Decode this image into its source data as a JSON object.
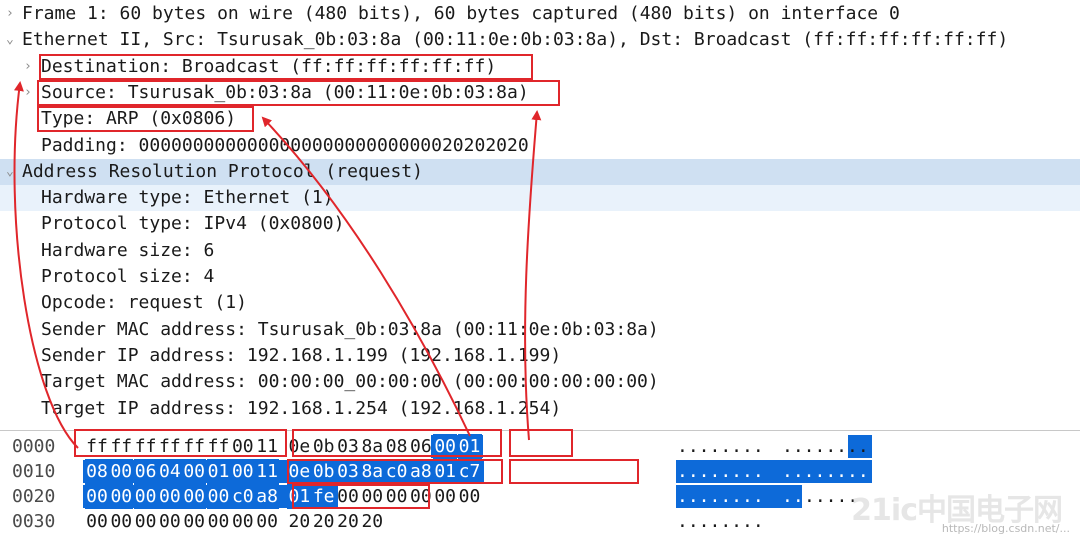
{
  "details": [
    {
      "level": 0,
      "twisty": "›",
      "text": "Frame 1: 60 bytes on wire (480 bits), 60 bytes captured (480 bits) on interface 0",
      "style": ""
    },
    {
      "level": 0,
      "twisty": "⌄",
      "text": "Ethernet II, Src: Tsurusak_0b:03:8a (00:11:0e:0b:03:8a), Dst: Broadcast (ff:ff:ff:ff:ff:ff)",
      "style": ""
    },
    {
      "level": 1,
      "twisty": "›",
      "text": "Destination: Broadcast (ff:ff:ff:ff:ff:ff)",
      "style": ""
    },
    {
      "level": 1,
      "twisty": "›",
      "text": "Source: Tsurusak_0b:03:8a (00:11:0e:0b:03:8a)",
      "style": ""
    },
    {
      "level": 1,
      "twisty": "",
      "text": "Type: ARP (0x0806)",
      "style": ""
    },
    {
      "level": 1,
      "twisty": "",
      "text": "Padding: 000000000000000000000000000020202020",
      "style": ""
    },
    {
      "level": 0,
      "twisty": "⌄",
      "text": "Address Resolution Protocol (request)",
      "style": "sel"
    },
    {
      "level": 1,
      "twisty": "",
      "text": "Hardware type: Ethernet (1)",
      "style": "sub"
    },
    {
      "level": 1,
      "twisty": "",
      "text": "Protocol type: IPv4 (0x0800)",
      "style": ""
    },
    {
      "level": 1,
      "twisty": "",
      "text": "Hardware size: 6",
      "style": ""
    },
    {
      "level": 1,
      "twisty": "",
      "text": "Protocol size: 4",
      "style": ""
    },
    {
      "level": 1,
      "twisty": "",
      "text": "Opcode: request (1)",
      "style": ""
    },
    {
      "level": 1,
      "twisty": "",
      "text": "Sender MAC address: Tsurusak_0b:03:8a (00:11:0e:0b:03:8a)",
      "style": ""
    },
    {
      "level": 1,
      "twisty": "",
      "text": "Sender IP address: 192.168.1.199 (192.168.1.199)",
      "style": ""
    },
    {
      "level": 1,
      "twisty": "",
      "text": "Target MAC address: 00:00:00_00:00:00 (00:00:00:00:00:00)",
      "style": ""
    },
    {
      "level": 1,
      "twisty": "",
      "text": "Target IP address: 192.168.1.254 (192.168.1.254)",
      "style": ""
    }
  ],
  "hex": [
    {
      "offset": "0000",
      "bytes": [
        "ff",
        "ff",
        "ff",
        "ff",
        "ff",
        "ff",
        "00",
        "11",
        "0e",
        "0b",
        "03",
        "8a",
        "08",
        "06",
        "00",
        "01"
      ],
      "ascii1": "........",
      "ascii2": "........",
      "hl_from": 14
    },
    {
      "offset": "0010",
      "bytes": [
        "08",
        "00",
        "06",
        "04",
        "00",
        "01",
        "00",
        "11",
        "0e",
        "0b",
        "03",
        "8a",
        "c0",
        "a8",
        "01",
        "c7"
      ],
      "ascii1": "........",
      "ascii2": "........",
      "hl_from": 0
    },
    {
      "offset": "0020",
      "bytes": [
        "00",
        "00",
        "00",
        "00",
        "00",
        "00",
        "c0",
        "a8",
        "01",
        "fe",
        "00",
        "00",
        "00",
        "00",
        "00",
        "00"
      ],
      "ascii1": "........",
      "ascii2": "..",
      "ascii3": "......",
      "hl_to": 9
    },
    {
      "offset": "0030",
      "bytes": [
        "00",
        "00",
        "00",
        "00",
        "00",
        "00",
        "00",
        "00",
        "20",
        "20",
        "20",
        "20"
      ],
      "ascii1": "........",
      "ascii2": ""
    }
  ],
  "colors": {
    "highlight": "#0d6ad9",
    "annotation": "#e0262b",
    "selected_row": "#cfe0f2"
  },
  "watermark": "https://blog.csdn.net/...",
  "logo": "21ic中国电子网"
}
